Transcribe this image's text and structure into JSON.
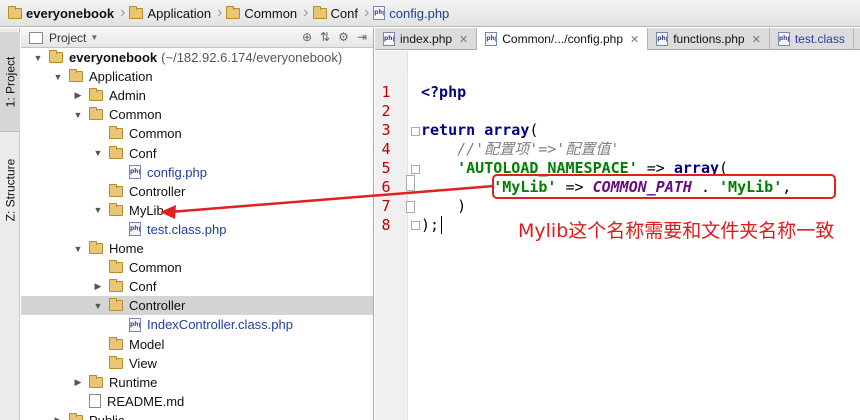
{
  "breadcrumb": [
    {
      "label": "everyonebook",
      "type": "folder",
      "bold": true
    },
    {
      "label": "Application",
      "type": "folder"
    },
    {
      "label": "Common",
      "type": "folder"
    },
    {
      "label": "Conf",
      "type": "folder"
    },
    {
      "label": "config.php",
      "type": "php"
    }
  ],
  "sidebar": {
    "project_tab": "1: Project",
    "structure_tab": "Z: Structure"
  },
  "project_panel": {
    "title": "Project",
    "tree": [
      {
        "label": "everyonebook",
        "path": "(~/182.92.6.174/everyonebook)",
        "type": "folder",
        "expanded": true,
        "depth": 0,
        "bold": true
      },
      {
        "label": "Application",
        "type": "folder",
        "expanded": true,
        "depth": 1
      },
      {
        "label": "Admin",
        "type": "folder",
        "expanded": false,
        "depth": 2
      },
      {
        "label": "Common",
        "type": "folder",
        "expanded": true,
        "depth": 2
      },
      {
        "label": "Common",
        "type": "folder",
        "depth": 3
      },
      {
        "label": "Conf",
        "type": "folder",
        "expanded": true,
        "depth": 3
      },
      {
        "label": "config.php",
        "type": "php",
        "depth": 4
      },
      {
        "label": "Controller",
        "type": "folder",
        "depth": 3
      },
      {
        "label": "MyLib",
        "type": "folder",
        "expanded": true,
        "depth": 3
      },
      {
        "label": "test.class.php",
        "type": "php",
        "depth": 4
      },
      {
        "label": "Home",
        "type": "folder",
        "expanded": true,
        "depth": 2
      },
      {
        "label": "Common",
        "type": "folder",
        "depth": 3
      },
      {
        "label": "Conf",
        "type": "folder",
        "expanded": false,
        "depth": 3
      },
      {
        "label": "Controller",
        "type": "folder",
        "expanded": true,
        "depth": 3,
        "selected": true
      },
      {
        "label": "IndexController.class.php",
        "type": "php",
        "depth": 4
      },
      {
        "label": "Model",
        "type": "folder",
        "depth": 3
      },
      {
        "label": "View",
        "type": "folder",
        "depth": 3
      },
      {
        "label": "Runtime",
        "type": "folder",
        "expanded": false,
        "depth": 2
      },
      {
        "label": "README.md",
        "type": "md",
        "depth": 2
      },
      {
        "label": "Public",
        "type": "folder",
        "expanded": false,
        "depth": 1
      }
    ]
  },
  "editor": {
    "tabs": [
      {
        "label": "index.php",
        "active": false
      },
      {
        "label": "Common/.../config.php",
        "active": true
      },
      {
        "label": "functions.php",
        "active": false
      },
      {
        "label": "test.class",
        "active": false
      }
    ],
    "line_numbers": [
      "1",
      "2",
      "3",
      "4",
      "5",
      "6",
      "7",
      "8"
    ],
    "lines": {
      "l1": "<?php",
      "l3_kw": "return array",
      "l3_end": "(",
      "l4": "    //'配置项'=>'配置值'",
      "l5_str": "    'AUTOLOAD_NAMESPACE'",
      "l5_op": " => ",
      "l5_kw": "array",
      "l5_end": "(",
      "l6_indent": "        ",
      "l6_key": "'MyLib'",
      "l6_op": " => ",
      "l6_const": "COMMON_PATH",
      "l6_dot": " . ",
      "l6_val": "'MyLib'",
      "l6_end": ",",
      "l7": "    )",
      "l8": ");"
    }
  },
  "annotation": {
    "text": "Mylib这个名称需要和文件夹名称一致",
    "color": "#e31a1a"
  }
}
